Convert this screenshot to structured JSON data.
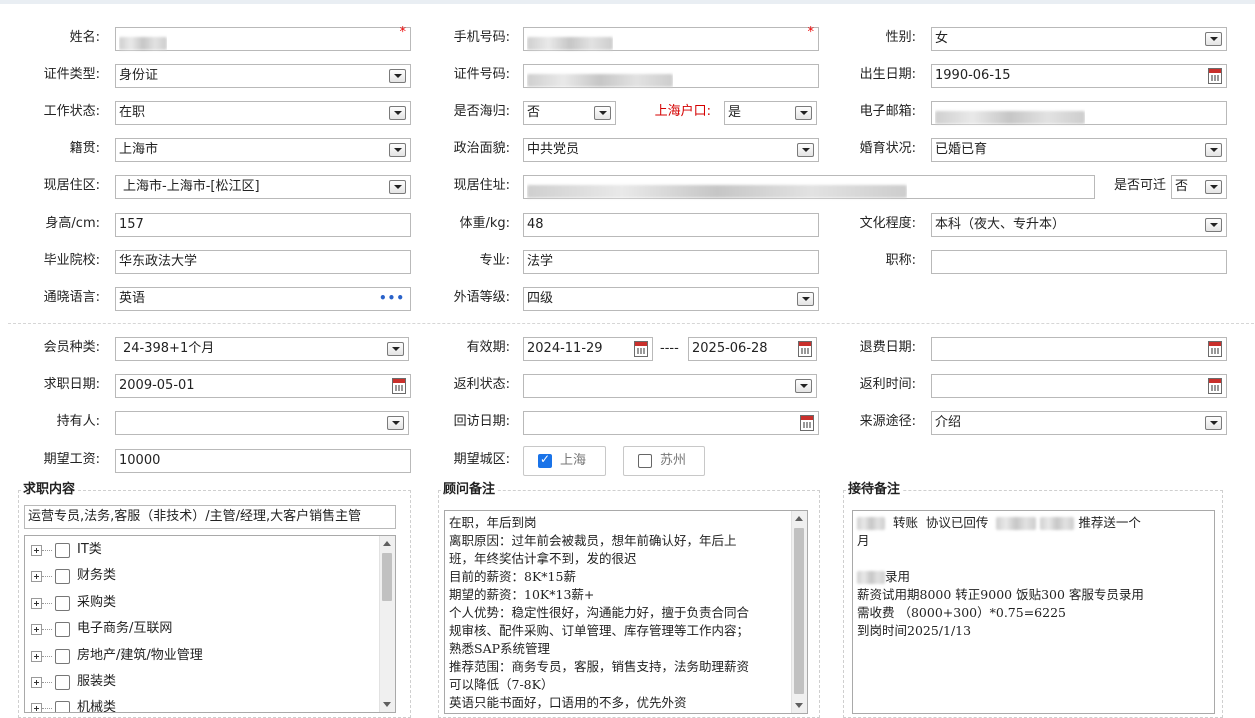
{
  "basic": {
    "name_label": "姓名:",
    "phone_label": "手机号码:",
    "gender_label": "性别:",
    "gender_value": "女",
    "idtype_label": "证件类型:",
    "idtype_value": "身份证",
    "idnum_label": "证件号码:",
    "birth_label": "出生日期:",
    "birth_value": "1990-06-15",
    "workstatus_label": "工作状态:",
    "workstatus_value": "在职",
    "overseas_label": "是否海归:",
    "overseas_value": "否",
    "hukou_label": "上海户口:",
    "hukou_value": "是",
    "email_label": "电子邮箱:",
    "native_label": "籍贯:",
    "native_value": "上海市",
    "political_label": "政治面貌:",
    "political_value": "中共党员",
    "marital_label": "婚育状况:",
    "marital_value": "已婚已育",
    "residence_label": "现居住区:",
    "residence_value": "上海市-上海市-[松江区]",
    "address_label": "现居住址:",
    "relocate_label": "是否可迁",
    "relocate_value": "否",
    "height_label": "身高/cm:",
    "height_value": "157",
    "weight_label": "体重/kg:",
    "weight_value": "48",
    "education_label": "文化程度:",
    "education_value": "本科（夜大、专升本）",
    "school_label": "毕业院校:",
    "school_value": "华东政法大学",
    "major_label": "专业:",
    "major_value": "法学",
    "title_label": "职称:",
    "language_label": "通晓语言:",
    "language_value": "英语",
    "langlevel_label": "外语等级:",
    "langlevel_value": "四级"
  },
  "member": {
    "type_label": "会员种类:",
    "type_value": "24-398+1个月",
    "validity_label": "有效期:",
    "valid_from": "2024-11-29",
    "valid_sep": "----",
    "valid_to": "2025-06-28",
    "refund_label": "退费日期:",
    "jobdate_label": "求职日期:",
    "jobdate_value": "2009-05-01",
    "rebate_status_label": "返利状态:",
    "rebate_time_label": "返利时间:",
    "holder_label": "持有人:",
    "visit_label": "回访日期:",
    "source_label": "来源途径:",
    "source_value": "介绍",
    "salary_label": "期望工资:",
    "salary_value": "10000",
    "city_label": "期望城区:",
    "city_options": [
      {
        "label": "上海",
        "checked": true
      },
      {
        "label": "苏州",
        "checked": false
      }
    ]
  },
  "job_content": {
    "title": "求职内容",
    "summary": "运营专员,法务,客服（非技术）/主管/经理,大客户销售主管",
    "tree": [
      "IT类",
      "财务类",
      "采购类",
      "电子商务/互联网",
      "房地产/建筑/物业管理",
      "服装类",
      "机械类"
    ]
  },
  "advisor_notes": {
    "title": "顾问备注",
    "lines": [
      "在职，年后到岗",
      "离职原因：过年前会被裁员，想年前确认好，年后上",
      "班，年终奖估计拿不到，发的很迟",
      "目前的薪资：8K*15薪",
      "期望的薪资：10K*13薪+",
      "个人优势：稳定性很好，沟通能力好，擅于负责合同合",
      "规审核、配件采购、订单管理、库存管理等工作内容；",
      "熟悉SAP系统管理",
      "推荐范围：商务专员，客服，销售支持，法务助理薪资",
      "可以降低（7-8K）",
      "英语只能书面好，口语用的不多，优先外资"
    ]
  },
  "reception_notes": {
    "title": "接待备注",
    "line1a": "转账  协议已回传",
    "line1b": "推荐送一个",
    "line2": "月",
    "line3": "录用",
    "line4": "薪资试用期8000 转正9000 饭贴300 客服专员录用",
    "line5": "需收费 （8000+300）*0.75=6225",
    "line6": "到岗时间2025/1/13"
  },
  "colors": {
    "accent_red": "#d40000",
    "check_blue": "#1a73e8",
    "border": "#b9b9b9"
  }
}
